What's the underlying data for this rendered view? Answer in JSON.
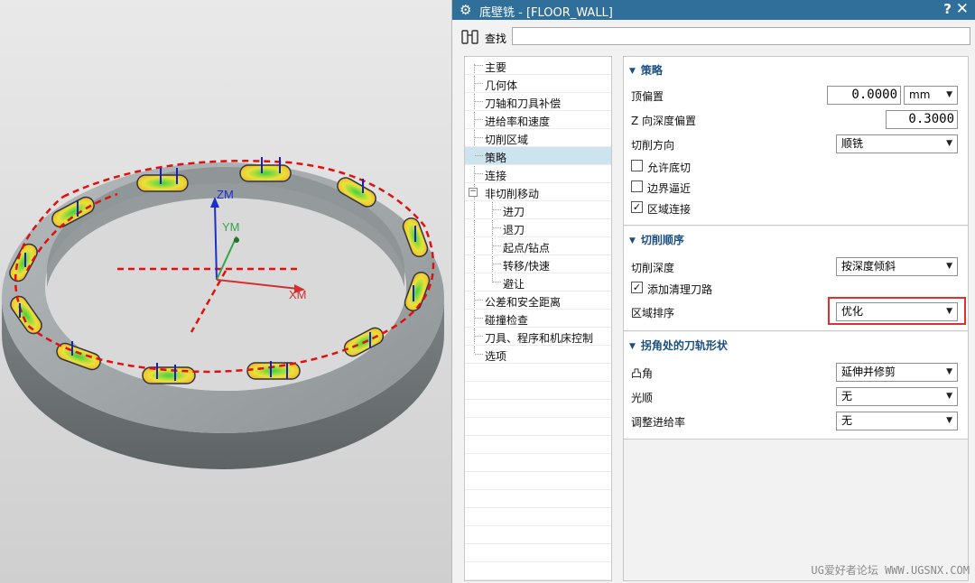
{
  "dialog": {
    "title": "底壁铣 - [FLOOR_WALL]",
    "help_label": "?",
    "close_label": "✕",
    "find_label": "查找",
    "find_value": ""
  },
  "tree": {
    "items": [
      {
        "label": "主要"
      },
      {
        "label": "几何体"
      },
      {
        "label": "刀轴和刀具补偿"
      },
      {
        "label": "进给率和速度"
      },
      {
        "label": "切削区域"
      },
      {
        "label": "策略"
      },
      {
        "label": "连接"
      },
      {
        "label": "非切削移动",
        "expand": "−"
      },
      {
        "label": "进刀"
      },
      {
        "label": "退刀"
      },
      {
        "label": "起点/钻点"
      },
      {
        "label": "转移/快速"
      },
      {
        "label": "避让"
      },
      {
        "label": "公差和安全距离"
      },
      {
        "label": "碰撞检查"
      },
      {
        "label": "刀具、程序和机床控制"
      },
      {
        "label": "选项"
      }
    ]
  },
  "strategy": {
    "header": "策略",
    "top_offset_label": "顶偏置",
    "top_offset_value": "0.0000",
    "top_offset_unit": "mm",
    "z_depth_offset_label": "Z 向深度偏置",
    "z_depth_offset_value": "0.3000",
    "cut_direction_label": "切削方向",
    "cut_direction_value": "顺铣",
    "allow_undercut_label": "允许底切",
    "allow_undercut_mark": "",
    "boundary_approach_label": "边界逼近",
    "boundary_approach_mark": "",
    "region_connect_label": "区域连接",
    "region_connect_mark": "✓"
  },
  "cut_order": {
    "header": "切削顺序",
    "depth_label": "切削深度",
    "depth_value": "按深度倾斜",
    "cleanup_label": "添加清理刀路",
    "cleanup_mark": "✓",
    "region_order_label": "区域排序",
    "region_order_value": "优化"
  },
  "corner": {
    "header": "拐角处的刀轨形状",
    "convex_label": "凸角",
    "convex_value": "延伸并修剪",
    "smooth_label": "光顺",
    "smooth_value": "无",
    "feed_label": "调整进给率",
    "feed_value": "无"
  },
  "viewport": {
    "axis_zm": "ZM",
    "axis_ym": "YM",
    "axis_xm": "XM"
  },
  "watermark": "UG爱好者论坛 WWW.UGSNX.COM",
  "colors": {
    "titlebar": "#2f6f99",
    "header_text": "#1b4f82",
    "highlight": "#e03030",
    "toolpath": "#e01010",
    "selected_row": "#cde3ee"
  }
}
